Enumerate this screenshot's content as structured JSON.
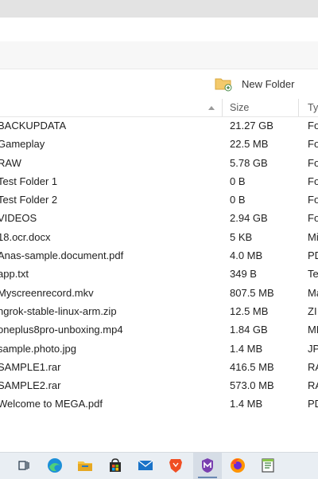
{
  "toolbar": {
    "new_folder_label": "New Folder"
  },
  "columns": {
    "size": "Size",
    "type": "Ty"
  },
  "files": [
    {
      "name": "BACKUPDATA",
      "size": "21.27 GB",
      "type": "Fo"
    },
    {
      "name": "Gameplay",
      "size": "22.5 MB",
      "type": "Fo"
    },
    {
      "name": "RAW",
      "size": "5.78 GB",
      "type": "Fo"
    },
    {
      "name": "Test Folder 1",
      "size": "0 B",
      "type": "Fo"
    },
    {
      "name": "Test Folder 2",
      "size": "0 B",
      "type": "Fo"
    },
    {
      "name": "VIDEOS",
      "size": "2.94 GB",
      "type": "Fo"
    },
    {
      "name": "18.ocr.docx",
      "size": "5 KB",
      "type": "Mi"
    },
    {
      "name": "Anas-sample.document.pdf",
      "size": "4.0 MB",
      "type": "PD"
    },
    {
      "name": "app.txt",
      "size": "349 B",
      "type": "Te"
    },
    {
      "name": "Myscreenrecord.mkv",
      "size": "807.5 MB",
      "type": "Ma"
    },
    {
      "name": "ngrok-stable-linux-arm.zip",
      "size": "12.5 MB",
      "type": "ZI"
    },
    {
      "name": "oneplus8pro-unboxing.mp4",
      "size": "1.84 GB",
      "type": "MF"
    },
    {
      "name": "sample.photo.jpg",
      "size": "1.4 MB",
      "type": "JP"
    },
    {
      "name": "SAMPLE1.rar",
      "size": "416.5 MB",
      "type": "RA"
    },
    {
      "name": "SAMPLE2.rar",
      "size": "573.0 MB",
      "type": "RA"
    },
    {
      "name": "Welcome to MEGA.pdf",
      "size": "1.4 MB",
      "type": "PD"
    }
  ],
  "taskbar": {
    "icons": [
      "task-view-icon",
      "edge-icon",
      "file-explorer-icon",
      "store-icon",
      "mail-icon",
      "brave-icon",
      "mega-icon",
      "firefox-icon",
      "notepad-icon"
    ]
  },
  "colors": {
    "accent": "#2b579a",
    "mega": "#7a3fb0",
    "brave": "#f04e23"
  }
}
